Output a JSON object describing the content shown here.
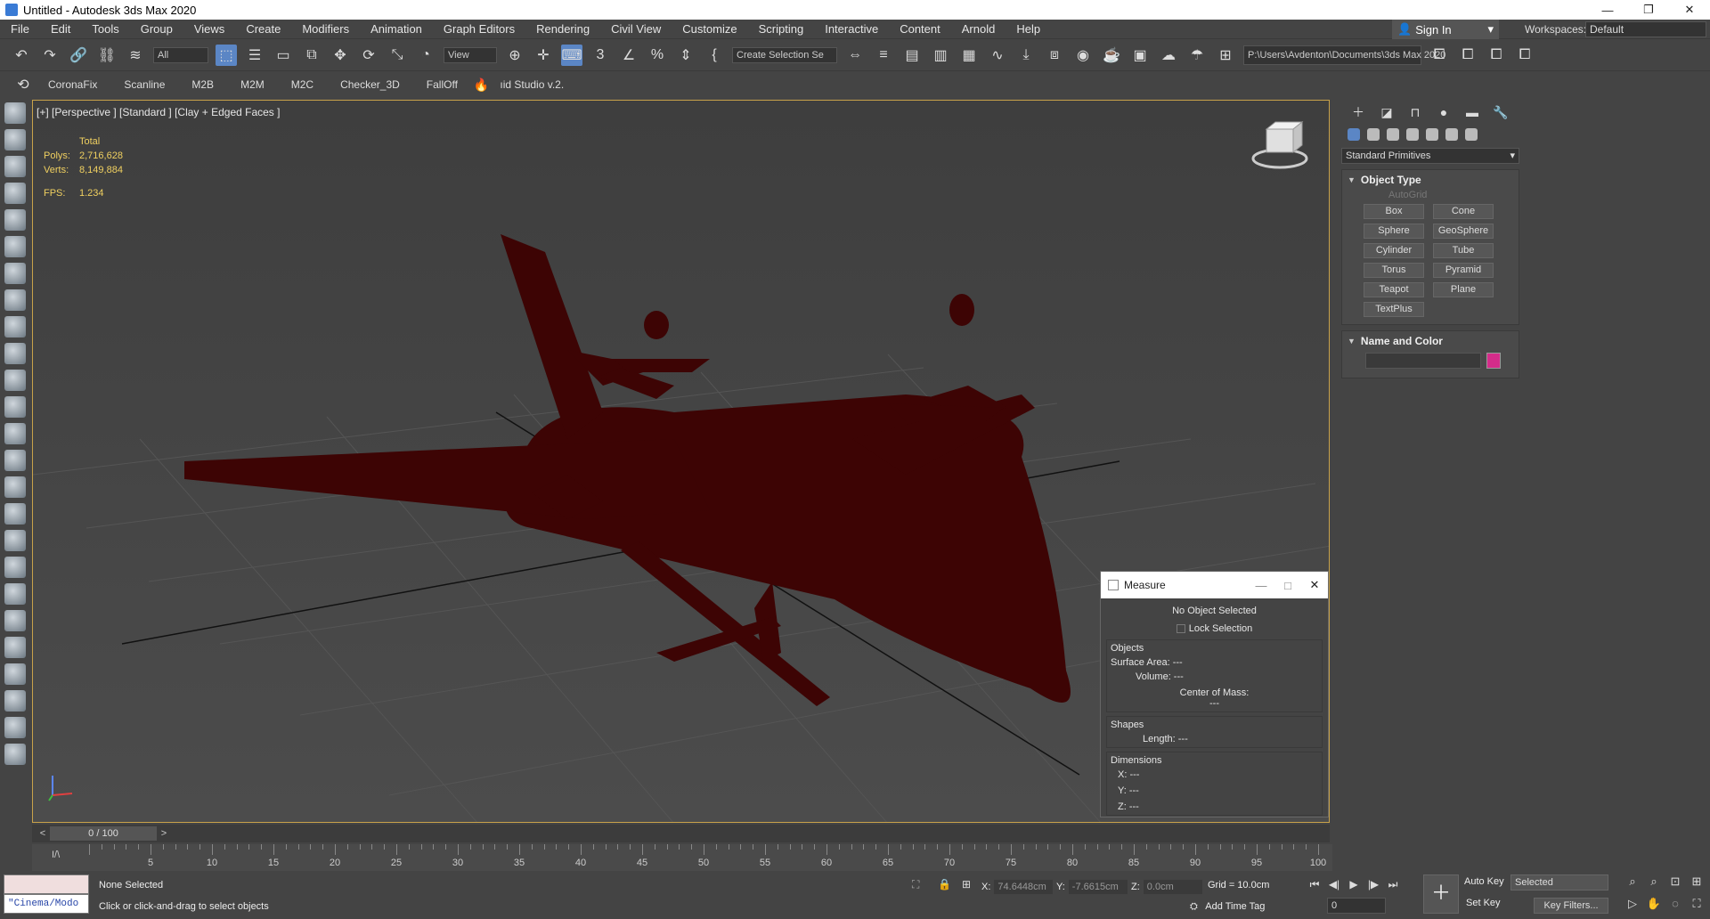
{
  "window": {
    "title": "Untitled - Autodesk 3ds Max 2020",
    "minimize": "—",
    "maximize": "❐",
    "close": "✕"
  },
  "menu": [
    "File",
    "Edit",
    "Tools",
    "Group",
    "Views",
    "Create",
    "Modifiers",
    "Animation",
    "Graph Editors",
    "Rendering",
    "Civil View",
    "Customize",
    "Scripting",
    "Interactive",
    "Content",
    "Arnold",
    "Help"
  ],
  "signin": {
    "label": "Sign In",
    "arrow": "▾"
  },
  "workspace": {
    "label": "Workspaces:",
    "value": "Default"
  },
  "toolbar": {
    "filter": "All",
    "refcoord": "View",
    "selection_set": "Create Selection Se",
    "project_path": "P:\\Users\\Avdenton\\Documents\\3ds Max 2020"
  },
  "render_toolbar": [
    "CoronaFix",
    "Scanline",
    "M2B",
    "M2M",
    "M2C",
    "Checker_3D",
    "FallOff",
    "ıid Studio v.2."
  ],
  "viewport": {
    "label": "[+] [Perspective ] [Standard ] [Clay + Edged Faces ]",
    "stats": {
      "total_label": "Total",
      "polys_label": "Polys:",
      "polys": "2,716,628",
      "verts_label": "Verts:",
      "verts": "8,149,884",
      "fps_label": "FPS:",
      "fps": "1.234"
    },
    "model_color": "#3d0404"
  },
  "measure": {
    "title": "Measure",
    "status": "No Object Selected",
    "lock_selection": "Lock Selection",
    "objects_label": "Objects",
    "surface_area": "Surface Area:  ---",
    "volume": "Volume:  ---",
    "center_of_mass": "Center of Mass:",
    "center_value": "---",
    "shapes_label": "Shapes",
    "length": "Length:  ---",
    "dimensions_label": "Dimensions",
    "dim_x": "X:   ---",
    "dim_y": "Y:   ---",
    "dim_z": "Z:   ---"
  },
  "command_panel": {
    "category": "Standard Primitives",
    "object_type_title": "Object Type",
    "autogrid": "AutoGrid",
    "buttons": [
      "Box",
      "Cone",
      "Sphere",
      "GeoSphere",
      "Cylinder",
      "Tube",
      "Torus",
      "Pyramid",
      "Teapot",
      "Plane",
      "TextPlus"
    ],
    "name_color_title": "Name and Color",
    "swatch_color": "#d42c8a"
  },
  "time": {
    "counter": "0 / 100",
    "ticks": [
      "0",
      "5",
      "10",
      "15",
      "20",
      "25",
      "30",
      "35",
      "40",
      "45",
      "50",
      "55",
      "60",
      "65",
      "70",
      "75",
      "80",
      "85",
      "90",
      "95",
      "100"
    ]
  },
  "status": {
    "selection": "None Selected",
    "prompt": "Click or click-and-drag to select objects",
    "maxscript": "\"Cinema/Modo",
    "x": "74.6448cm",
    "y": "-7.6615cm",
    "z": "0.0cm",
    "grid": "Grid = 10.0cm",
    "add_time_tag": "Add Time Tag",
    "frame": "0",
    "auto_key": "Auto Key",
    "set_key": "Set Key",
    "selected": "Selected",
    "key_filters": "Key Filters..."
  }
}
